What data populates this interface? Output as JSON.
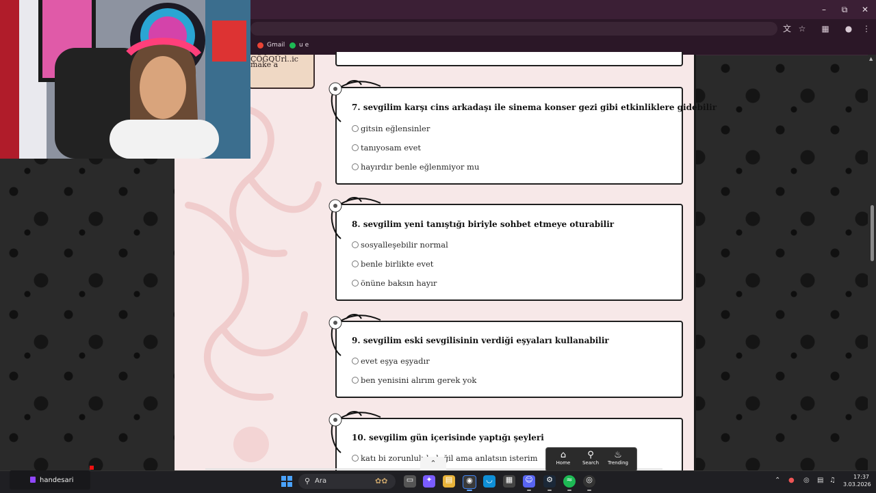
{
  "browser": {
    "bookmarks": [
      {
        "label": "Gmail",
        "color": "#ea4335"
      },
      {
        "label": "u e",
        "color": "#1db954"
      }
    ]
  },
  "sidebar_card": {
    "lines": [
      "ÇÖĞQÜrl..ic",
      "make a"
    ]
  },
  "questions": [
    {
      "title": "7. sevgilim karşı cins arkadaşı ile sinema konser gezi gibi etkinliklere gidebilir",
      "options": [
        "gitsin eğlensinler",
        "tanıyosam evet",
        "hayırdır benle eğlenmiyor mu"
      ]
    },
    {
      "title": "8. sevgilim yeni tanıştığı biriyle sohbet etmeye oturabilir",
      "options": [
        "sosyalleşebilir normal",
        "benle birlikte evet",
        "önüne baksın hayır"
      ]
    },
    {
      "title": "9. sevgilim eski sevgilisinin verdiği eşyaları kullanabilir",
      "options": [
        "evet eşya eşyadır",
        "ben yenisini alırım gerek yok"
      ]
    },
    {
      "title": "10. sevgilim gün içerisinde yaptığı şeyleri",
      "options": [
        "katı bi zorunluluk değil ama anlatsın isterim"
      ]
    }
  ],
  "mini_nav": {
    "items": [
      {
        "label": "Home",
        "icon": "home-icon"
      },
      {
        "label": "Search",
        "icon": "search-icon"
      },
      {
        "label": "Trending",
        "icon": "flame-icon"
      }
    ]
  },
  "taskbar": {
    "streamer_name": "handesari",
    "search_placeholder": "Ara",
    "time": "17:37",
    "date": "3.03.2026"
  }
}
